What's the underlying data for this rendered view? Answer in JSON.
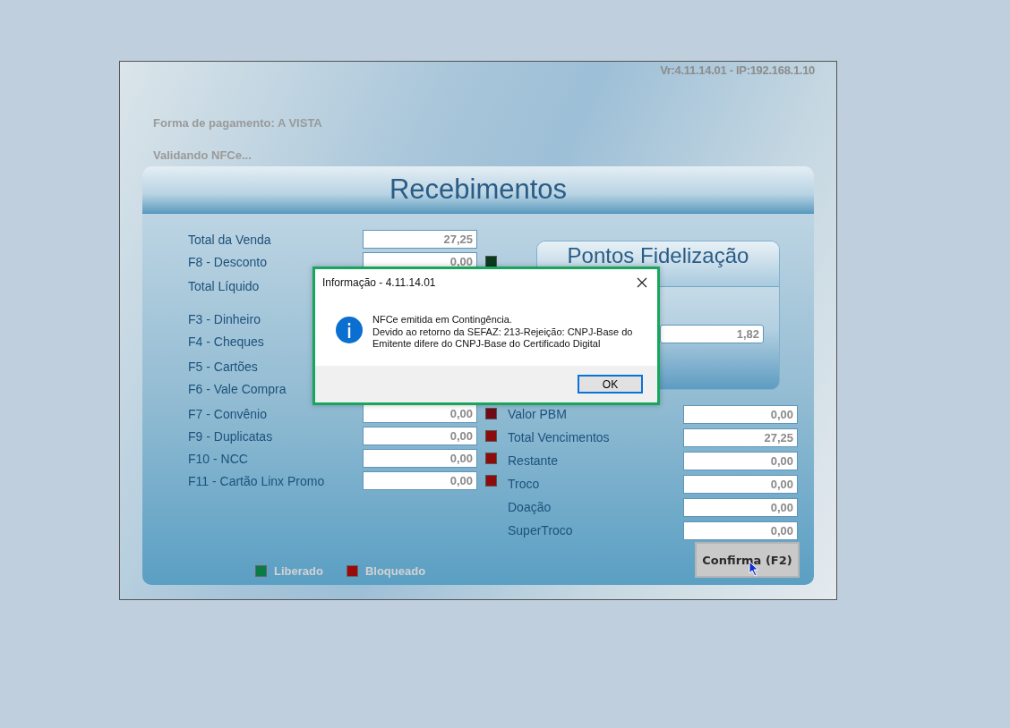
{
  "app": {
    "version": "Vr:4.11.14.01 - IP:192.168.1.10",
    "payment_method": "Forma de pagamento: A VISTA",
    "status_message": "Validando NFCe..."
  },
  "panel": {
    "title": "Recebimentos",
    "left_rows": [
      {
        "label": "Total da Venda",
        "value": "27,25"
      },
      {
        "label": "F8 - Desconto",
        "value": "0,00",
        "color": "#0b3a1c"
      },
      {
        "label": "Total Líquido"
      },
      {
        "label": "F3 - Dinheiro"
      },
      {
        "label": "F4 - Cheques"
      },
      {
        "label": "F5 - Cartões"
      },
      {
        "label": "F6 - Vale Compra"
      },
      {
        "label": "F7 - Convênio",
        "value": "0,00",
        "color": "#6e0b16"
      },
      {
        "label": "F9 - Duplicatas",
        "value": "0,00",
        "color": "#8e0b0b"
      },
      {
        "label": "F10 - NCC",
        "value": "0,00",
        "color": "#8e0b0b"
      },
      {
        "label": "F11 - Cartão Linx Promo",
        "value": "0,00",
        "color": "#8e0b0b"
      }
    ],
    "loyalty": {
      "title": "Pontos Fidelização",
      "value": "1,82"
    },
    "right_rows": [
      {
        "label": "Valor PBM",
        "value": "0,00"
      },
      {
        "label": "Total Vencimentos",
        "value": "27,25"
      },
      {
        "label": "Restante",
        "value": "0,00"
      },
      {
        "label": "Troco",
        "value": "0,00"
      },
      {
        "label": "Doação",
        "value": "0,00"
      },
      {
        "label": "SuperTroco",
        "value": "0,00"
      }
    ],
    "confirm_button": "Confirma (F2)",
    "legend": [
      {
        "label": "Liberado",
        "color": "#0b7a45"
      },
      {
        "label": "Bloqueado",
        "color": "#9a0a0a"
      }
    ]
  },
  "dialog": {
    "title": "Informação - 4.11.14.01",
    "paragraphs": [
      "NFCe emitida em Contingência.",
      "Devido ao retorno da SEFAZ: 213-Rejeição: CNPJ-Base do Emitente difere do CNPJ-Base do Certificado Digital"
    ],
    "button": "OK"
  }
}
